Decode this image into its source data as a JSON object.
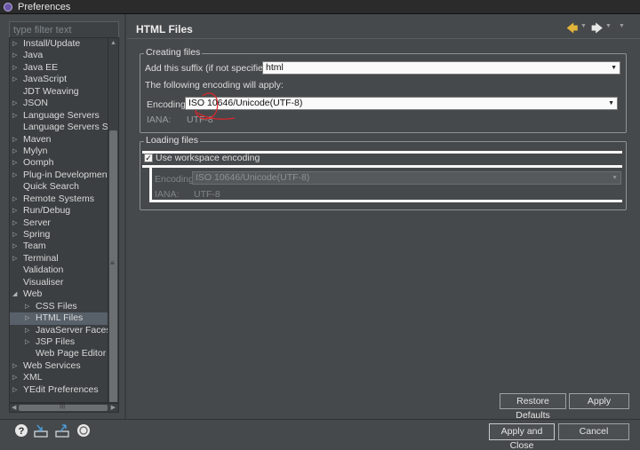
{
  "window": {
    "title": "Preferences"
  },
  "filter": {
    "value": "type filter text"
  },
  "tree": [
    {
      "label": "Install/Update",
      "depth": 0,
      "twisty": "collapsed"
    },
    {
      "label": "Java",
      "depth": 0,
      "twisty": "collapsed"
    },
    {
      "label": "Java EE",
      "depth": 0,
      "twisty": "collapsed"
    },
    {
      "label": "JavaScript",
      "depth": 0,
      "twisty": "collapsed"
    },
    {
      "label": "JDT Weaving",
      "depth": 0,
      "twisty": "none"
    },
    {
      "label": "JSON",
      "depth": 0,
      "twisty": "collapsed"
    },
    {
      "label": "Language Servers",
      "depth": 0,
      "twisty": "collapsed"
    },
    {
      "label": "Language Servers STS",
      "depth": 0,
      "twisty": "none"
    },
    {
      "label": "Maven",
      "depth": 0,
      "twisty": "collapsed"
    },
    {
      "label": "Mylyn",
      "depth": 0,
      "twisty": "collapsed"
    },
    {
      "label": "Oomph",
      "depth": 0,
      "twisty": "collapsed"
    },
    {
      "label": "Plug-in Development",
      "depth": 0,
      "twisty": "collapsed"
    },
    {
      "label": "Quick Search",
      "depth": 0,
      "twisty": "none"
    },
    {
      "label": "Remote Systems",
      "depth": 0,
      "twisty": "collapsed"
    },
    {
      "label": "Run/Debug",
      "depth": 0,
      "twisty": "collapsed"
    },
    {
      "label": "Server",
      "depth": 0,
      "twisty": "collapsed"
    },
    {
      "label": "Spring",
      "depth": 0,
      "twisty": "collapsed"
    },
    {
      "label": "Team",
      "depth": 0,
      "twisty": "collapsed"
    },
    {
      "label": "Terminal",
      "depth": 0,
      "twisty": "collapsed"
    },
    {
      "label": "Validation",
      "depth": 0,
      "twisty": "none"
    },
    {
      "label": "Visualiser",
      "depth": 0,
      "twisty": "none"
    },
    {
      "label": "Web",
      "depth": 0,
      "twisty": "expanded"
    },
    {
      "label": "CSS Files",
      "depth": 1,
      "twisty": "collapsed"
    },
    {
      "label": "HTML Files",
      "depth": 1,
      "twisty": "collapsed",
      "selected": true
    },
    {
      "label": "JavaServer Faces Too",
      "depth": 1,
      "twisty": "collapsed"
    },
    {
      "label": "JSP Files",
      "depth": 1,
      "twisty": "collapsed"
    },
    {
      "label": "Web Page Editor",
      "depth": 1,
      "twisty": "none"
    },
    {
      "label": "Web Services",
      "depth": 0,
      "twisty": "collapsed"
    },
    {
      "label": "XML",
      "depth": 0,
      "twisty": "collapsed"
    },
    {
      "label": "YEdit Preferences",
      "depth": 0,
      "twisty": "collapsed"
    }
  ],
  "page": {
    "title": "HTML Files"
  },
  "creating": {
    "legend": "Creating files",
    "suffix_label": "Add this suffix (if not specified):",
    "suffix_value": "html",
    "apply_note": "The following encoding will apply:",
    "encoding_label": "Encoding:",
    "encoding_value": "ISO 10646/Unicode(UTF-8)",
    "iana_label": "IANA:",
    "iana_value": "UTF-8"
  },
  "loading": {
    "legend": "Loading files",
    "workspace_label": "Use workspace encoding",
    "workspace_checked": true,
    "encoding_label": "Encoding:",
    "encoding_value": "ISO 10646/Unicode(UTF-8)",
    "iana_label": "IANA:",
    "iana_value": "UTF-8"
  },
  "buttons": {
    "restore_defaults": "Restore Defaults",
    "apply": "Apply",
    "apply_close": "Apply and Close",
    "cancel": "Cancel"
  },
  "icons": {
    "help": "help-icon",
    "import": "import-icon",
    "export": "export-icon",
    "oomph": "oomph-preference-recorder-icon",
    "back": "back-arrow-icon",
    "forward": "forward-arrow-icon"
  },
  "colors": {
    "annotation": "#e0252a",
    "back_arrow": "#e2b43a"
  }
}
